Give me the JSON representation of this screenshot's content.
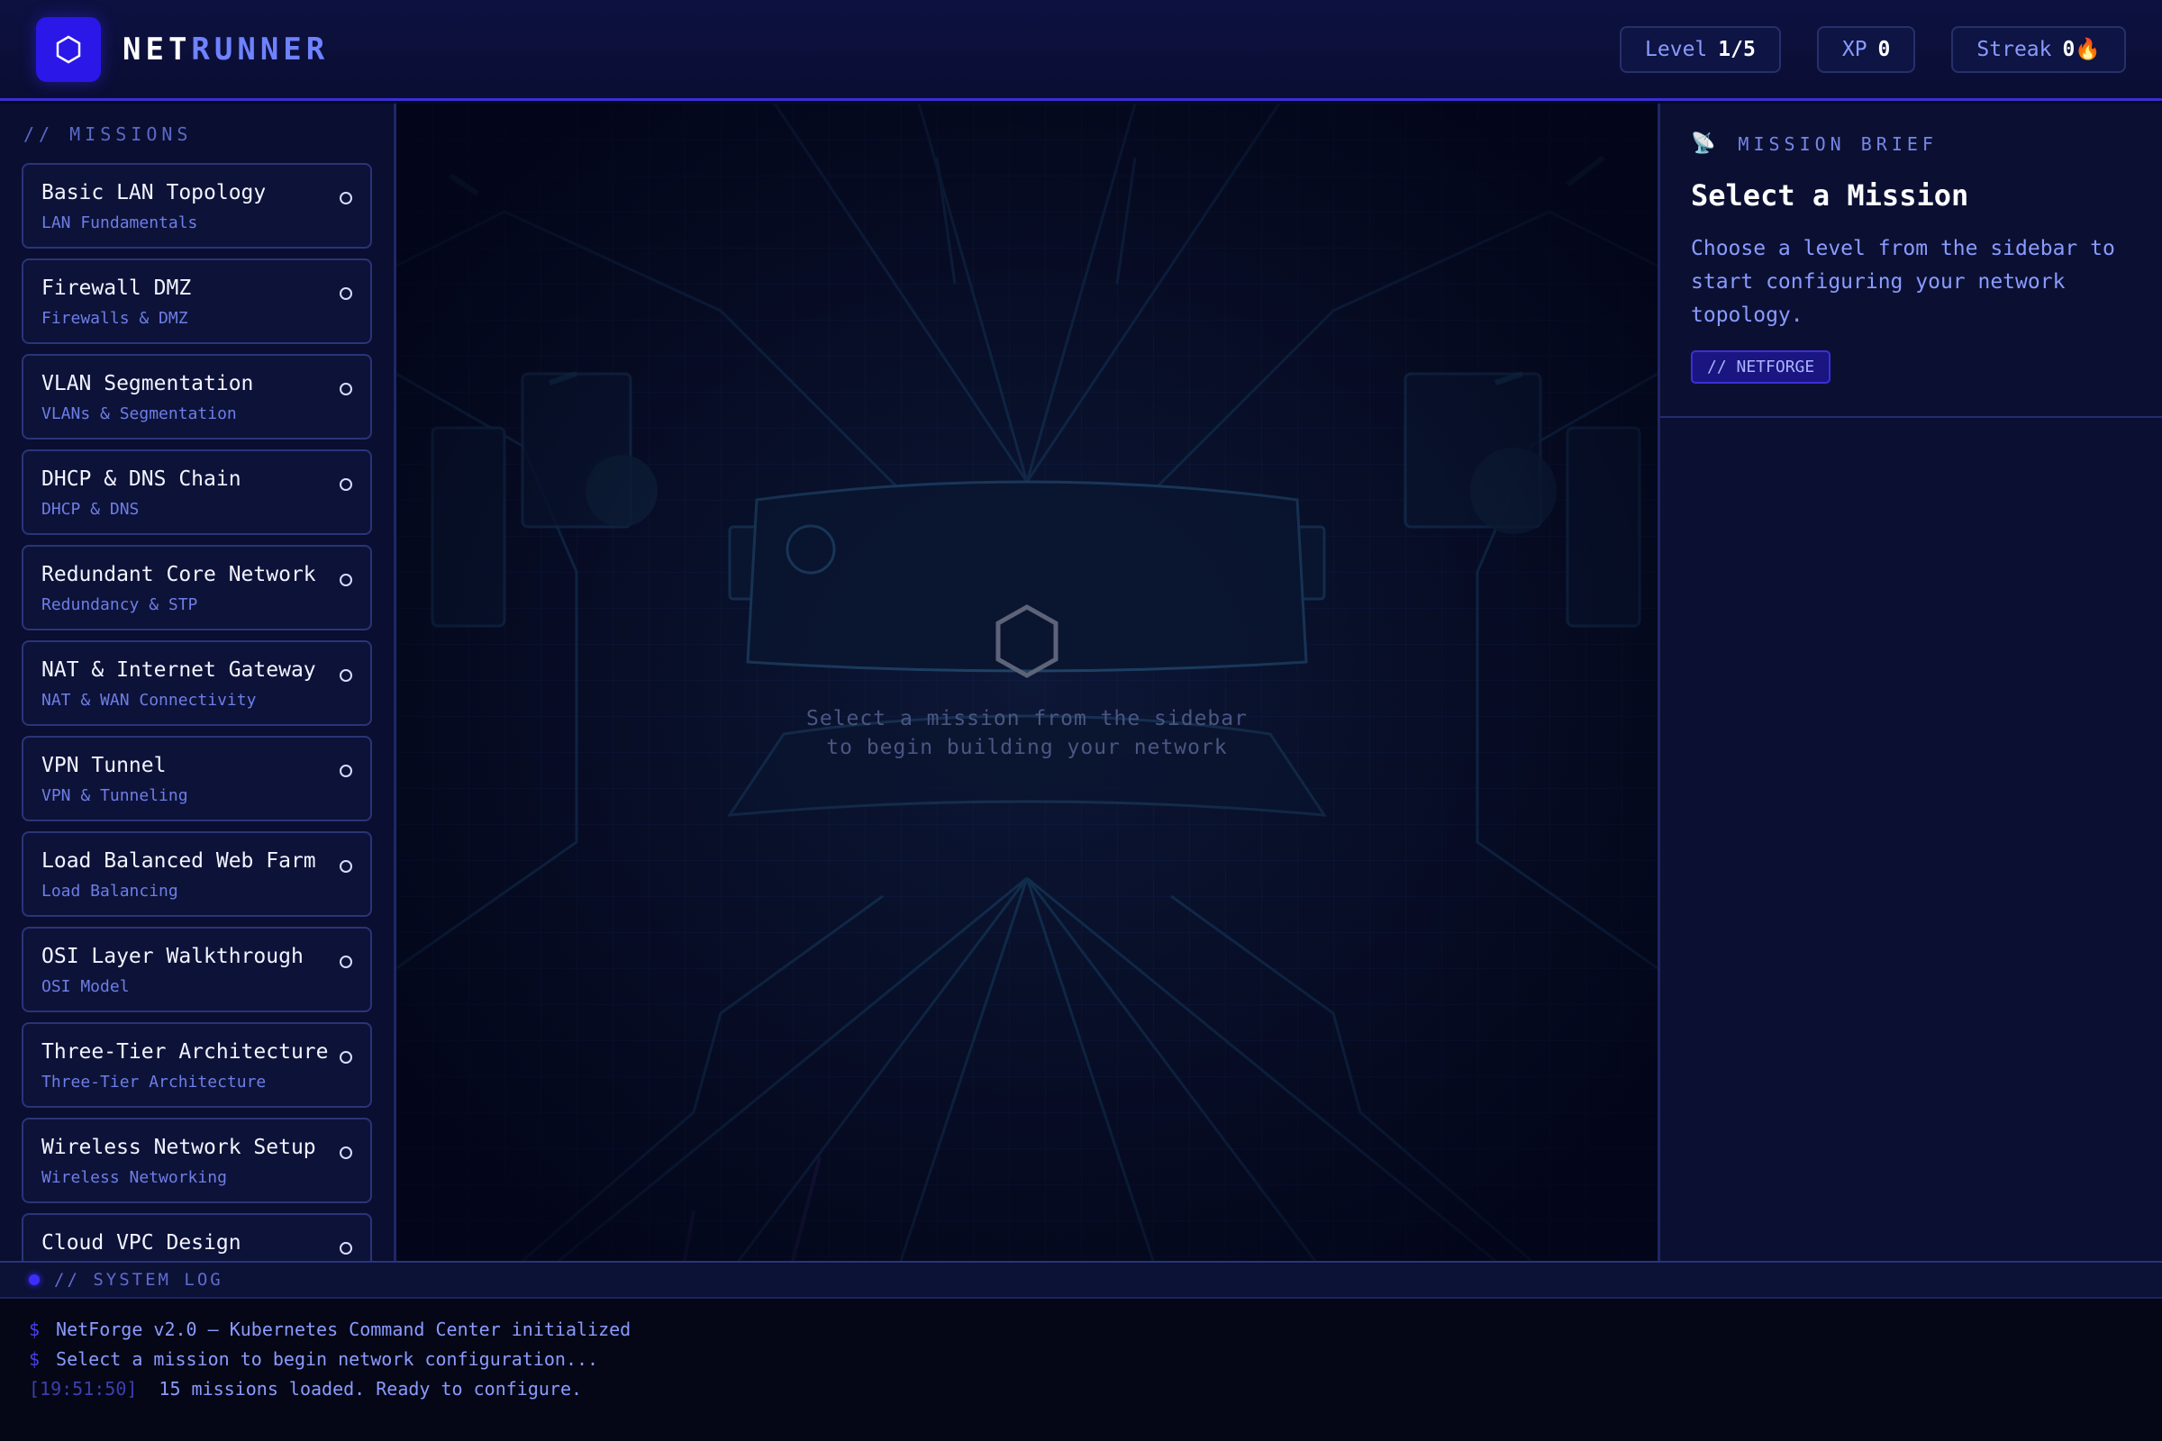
{
  "header": {
    "logo_glyph": "⬡",
    "title_part1": "NET",
    "title_part2": "RUNNER",
    "stats": [
      {
        "label": "Level",
        "value": "1/5"
      },
      {
        "label": "XP",
        "value": "0"
      },
      {
        "label": "Streak",
        "value": "0🔥"
      }
    ]
  },
  "sidebar": {
    "heading": "// MISSIONS",
    "missions": [
      {
        "name": "Basic LAN Topology",
        "category": "LAN Fundamentals"
      },
      {
        "name": "Firewall DMZ",
        "category": "Firewalls & DMZ"
      },
      {
        "name": "VLAN Segmentation",
        "category": "VLANs & Segmentation"
      },
      {
        "name": "DHCP & DNS Chain",
        "category": "DHCP & DNS"
      },
      {
        "name": "Redundant Core Network",
        "category": "Redundancy & STP"
      },
      {
        "name": "NAT & Internet Gateway",
        "category": "NAT & WAN Connectivity"
      },
      {
        "name": "VPN Tunnel",
        "category": "VPN & Tunneling"
      },
      {
        "name": "Load Balanced Web Farm",
        "category": "Load Balancing"
      },
      {
        "name": "OSI Layer Walkthrough",
        "category": "OSI Model"
      },
      {
        "name": "Three-Tier Architecture",
        "category": "Three-Tier Architecture"
      },
      {
        "name": "Wireless Network Setup",
        "category": "Wireless Networking"
      },
      {
        "name": "Cloud VPC Design",
        "category": ""
      }
    ]
  },
  "canvas": {
    "empty_line1": "Select a mission from the sidebar",
    "empty_line2": "to begin building your network"
  },
  "brief": {
    "heading": "MISSION BRIEF",
    "icon": "📡",
    "title": "Select a Mission",
    "description": "Choose a level from the sidebar to start configuring your network topology.",
    "tag": "// NETFORGE"
  },
  "log": {
    "heading": "// SYSTEM LOG",
    "lines": [
      {
        "prefix": "$",
        "text": "NetForge v2.0 — Kubernetes Command Center initialized"
      },
      {
        "prefix": "$",
        "text": "Select a mission to begin network configuration..."
      },
      {
        "prefix": "[19:51:50]",
        "text": "15 missions loaded. Ready to configure."
      }
    ]
  },
  "colors": {
    "accent": "#2a17e8",
    "brand_secondary": "#6f82ff",
    "background": "#070a23"
  }
}
